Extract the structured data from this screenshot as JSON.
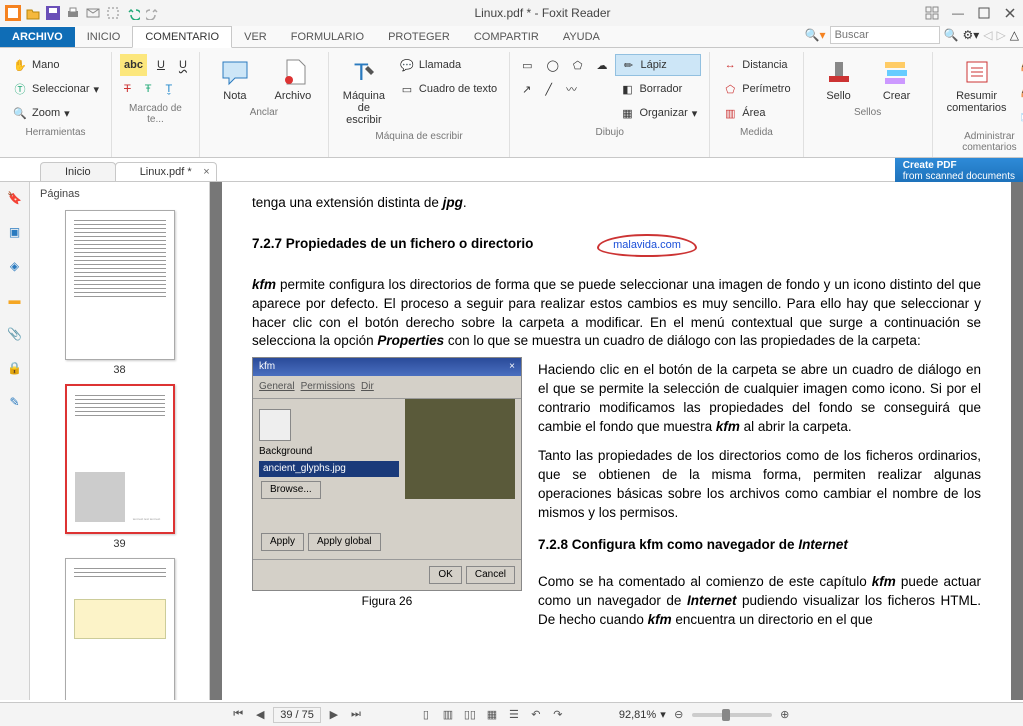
{
  "titlebar": {
    "title": "Linux.pdf * - Foxit Reader"
  },
  "menutabs": {
    "file": "ARCHIVO",
    "home": "INICIO",
    "comment": "COMENTARIO",
    "view": "VER",
    "form": "FORMULARIO",
    "protect": "PROTEGER",
    "share": "COMPARTIR",
    "help": "AYUDA"
  },
  "search": {
    "placeholder": "Buscar"
  },
  "ribbon": {
    "tools": {
      "hand": "Mano",
      "select": "Seleccionar",
      "zoom": "Zoom",
      "group": "Herramientas"
    },
    "markup": {
      "group": "Marcado de te..."
    },
    "anchor": {
      "note": "Nota",
      "file": "Archivo",
      "group": "Anclar"
    },
    "typewriter": {
      "tw": "Máquina de\nescribir",
      "callout": "Llamada",
      "textbox": "Cuadro de texto",
      "group": "Máquina de escribir"
    },
    "drawing": {
      "pencil": "Lápiz",
      "eraser": "Borrador",
      "organize": "Organizar",
      "group": "Dibujo"
    },
    "measure": {
      "distance": "Distancia",
      "perimeter": "Perímetro",
      "area": "Área",
      "group": "Medida"
    },
    "stamps": {
      "stamp": "Sello",
      "create": "Crear",
      "group": "Sellos"
    },
    "manage": {
      "summarize": "Resumir\ncomentarios",
      "group": "Administrar comentarios"
    }
  },
  "doctabs": {
    "start": "Inicio",
    "doc": "Linux.pdf *"
  },
  "promo": {
    "line1": "Create PDF",
    "line2": "from scanned documents"
  },
  "thumbs": {
    "title": "Páginas",
    "p1": "38",
    "p2": "39",
    "p3": "40"
  },
  "page": {
    "intro_trail": "tenga una extensión distinta de ",
    "jpg": "jpg",
    "h727": "7.2.7  Propiedades de un fichero o directorio",
    "annot": "malavida.com",
    "para1a": "kfm",
    "para1b": " permite configura los directorios de forma que se puede seleccionar una imagen de fondo y un icono distinto del que aparece por defecto. El proceso a seguir para realizar estos cambios es muy sencillo. Para ello hay que seleccionar y hacer clic con el botón derecho sobre la carpeta a modificar. En el menú contextual que surge a continuación se selecciona la opción ",
    "properties": "Properties",
    "para1c": " con lo que se muestra un cuadro de diálogo con las propiedades de la carpeta:",
    "para2a": "Haciendo clic en el botón de la carpeta se abre un cuadro de diálogo en el que se permite la selección de cualquier imagen como icono. Si por el contrario modificamos las propiedades del fondo se conseguirá que cambie el fondo que muestra ",
    "para2b": " al abrir la carpeta.",
    "para3a": "Tanto las propiedades de los directorios como de los ficheros ordinarios, que se obtienen de la misma forma, permiten realizar algunas operaciones básicas sobre los archivos como cambiar el nombre de los mismos y los permisos.",
    "h728": "7.2.8 Configura kfm como navegador de ",
    "internet": "Internet",
    "para4a": "Como se ha comentado al comienzo de este capítulo ",
    "para4b": " puede actuar como un navegador de ",
    "para4c": " pudiendo visualizar los ficheros HTML. De hecho cuando ",
    "para4d": " encuentra un directorio en el que",
    "kfm_title": "kfm",
    "kfm_general": "General",
    "kfm_perm": "Permissions",
    "kfm_dir": "Dir",
    "kfm_bg": "Background",
    "kfm_file": "ancient_glyphs.jpg",
    "kfm_browse": "Browse...",
    "kfm_apply": "Apply",
    "kfm_applyg": "Apply global",
    "kfm_ok": "OK",
    "kfm_cancel": "Cancel",
    "figcap": "Figura 26"
  },
  "status": {
    "page": "39 / 75",
    "zoom": "92,81%"
  }
}
